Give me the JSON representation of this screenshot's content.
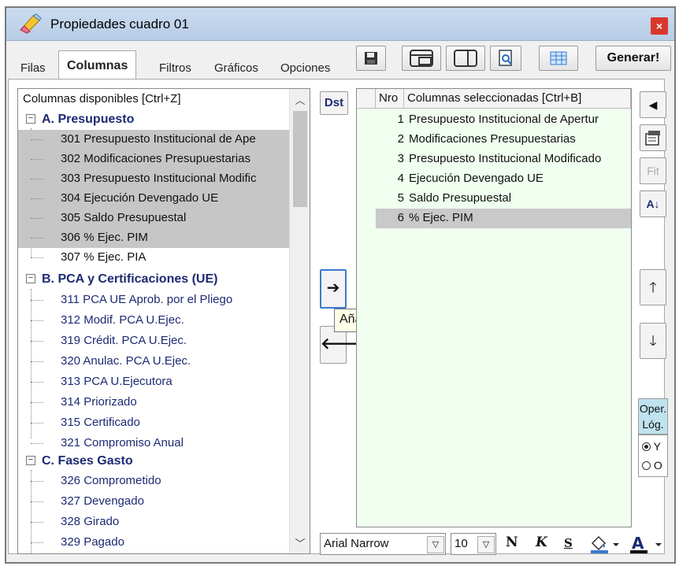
{
  "window": {
    "title": "Propiedades cuadro 01",
    "close": "×"
  },
  "tabs": [
    {
      "label": "Filas"
    },
    {
      "label": "Columnas"
    },
    {
      "label": "Filtros"
    },
    {
      "label": "Gráficos"
    },
    {
      "label": "Opciones"
    }
  ],
  "toolbar": {
    "generate_label": "Generar!"
  },
  "available": {
    "header": "Columnas disponibles     [Ctrl+Z]",
    "groups": [
      {
        "label": "A. Presupuesto",
        "expander": "−",
        "items": [
          {
            "label": "301 Presupuesto Institucional de Ape"
          },
          {
            "label": "302 Modificaciones Presupuestarias"
          },
          {
            "label": "303 Presupuesto Institucional Modific"
          },
          {
            "label": "304 Ejecución Devengado UE"
          },
          {
            "label": "305 Saldo Presupuestal"
          },
          {
            "label": "306 % Ejec. PIM"
          },
          {
            "label": "307 % Ejec. PIA"
          }
        ]
      },
      {
        "label": "B. PCA y Certificaciones (UE)",
        "expander": "−",
        "items": [
          {
            "label": "311 PCA UE Aprob. por el Pliego"
          },
          {
            "label": "312 Modif. PCA U.Ejec."
          },
          {
            "label": "319 Crédit. PCA U.Ejec."
          },
          {
            "label": "320 Anulac. PCA U.Ejec."
          },
          {
            "label": "313 PCA U.Ejecutora"
          },
          {
            "label": "314 Priorizado"
          },
          {
            "label": "315 Certificado"
          },
          {
            "label": "321 Compromiso Anual"
          }
        ]
      },
      {
        "label": "C. Fases Gasto",
        "expander": "−",
        "items": [
          {
            "label": "326 Comprometido"
          },
          {
            "label": "327 Devengado"
          },
          {
            "label": "328 Girado"
          },
          {
            "label": "329 Pagado"
          }
        ]
      }
    ]
  },
  "middle": {
    "dst_label": "Dst",
    "add_arrow": "➔",
    "remove_arrow": "🡐",
    "tooltip": "Añadir Columna"
  },
  "selected": {
    "header_nro": "Nro",
    "header_col": "Columnas seleccionadas   [Ctrl+B]",
    "rows": [
      {
        "nro": "1",
        "label": "Presupuesto Institucional de Apertur"
      },
      {
        "nro": "2",
        "label": "Modificaciones Presupuestarias"
      },
      {
        "nro": "3",
        "label": "Presupuesto Institucional Modificado"
      },
      {
        "nro": "4",
        "label": "Ejecución Devengado UE"
      },
      {
        "nro": "5",
        "label": "Saldo Presupuestal"
      },
      {
        "nro": "6",
        "label": "% Ejec. PIM"
      }
    ]
  },
  "side": {
    "fit_label": "Fit",
    "sort_label": "A↓",
    "oper_label": "Oper. Lóg.",
    "radio_y": "Y",
    "radio_o": "O"
  },
  "format": {
    "font": "Arial Narrow",
    "size": "10",
    "bold": "N",
    "italic": "K",
    "underline": "S"
  }
}
